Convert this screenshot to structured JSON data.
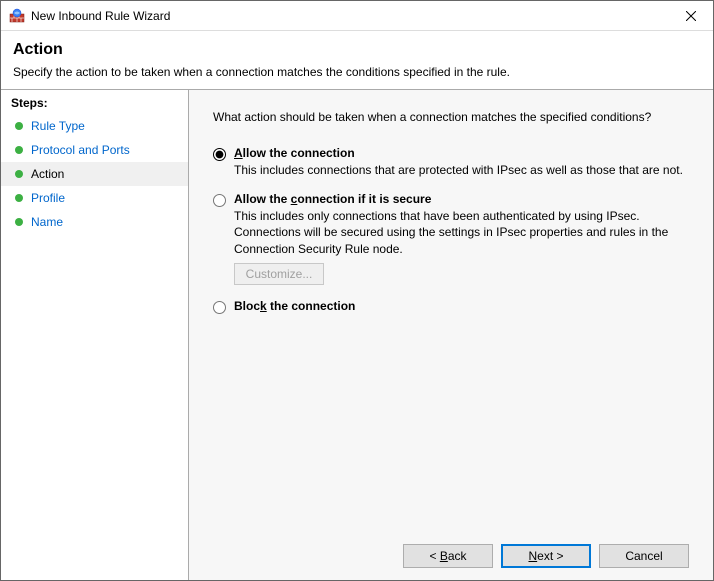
{
  "window": {
    "title": "New Inbound Rule Wizard"
  },
  "header": {
    "title": "Action",
    "description": "Specify the action to be taken when a connection matches the conditions specified in the rule."
  },
  "sidebar": {
    "steps_label": "Steps:",
    "items": [
      {
        "label": "Rule Type",
        "current": false
      },
      {
        "label": "Protocol and Ports",
        "current": false
      },
      {
        "label": "Action",
        "current": true
      },
      {
        "label": "Profile",
        "current": false
      },
      {
        "label": "Name",
        "current": false
      }
    ]
  },
  "main": {
    "prompt": "What action should be taken when a connection matches the specified conditions?",
    "options": [
      {
        "id": "allow",
        "title_pre": "A",
        "title_rest": "llow the connection",
        "desc": "This includes connections that are protected with IPsec as well as those that are not.",
        "selected": true
      },
      {
        "id": "allow-secure",
        "title_pre": "Allow the ",
        "title_ul": "c",
        "title_post": "onnection if it is secure",
        "desc": "This includes only connections that have been authenticated by using IPsec. Connections will be secured using the settings in IPsec properties and rules in the Connection Security Rule node.",
        "customize_label": "Customize...",
        "selected": false
      },
      {
        "id": "block",
        "title_pre": "Bloc",
        "title_ul": "k",
        "title_post": " the connection",
        "desc": "",
        "selected": false
      }
    ]
  },
  "footer": {
    "back_pre": "< ",
    "back_ul": "B",
    "back_post": "ack",
    "next_pre": "",
    "next_ul": "N",
    "next_post": "ext >",
    "cancel": "Cancel"
  }
}
